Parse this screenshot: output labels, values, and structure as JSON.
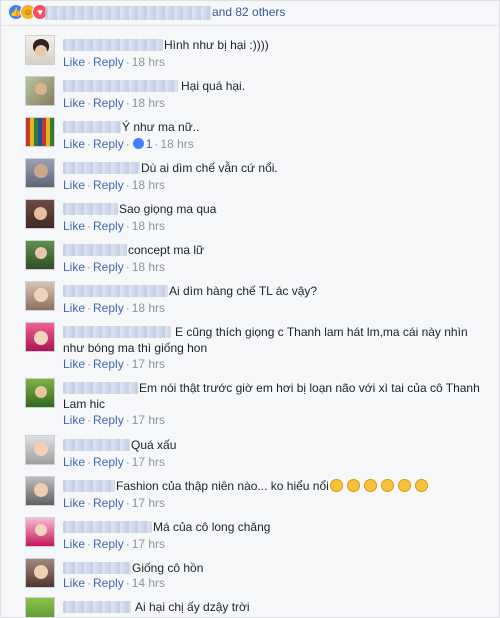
{
  "reactions_bar": {
    "others_text": "and 82 others",
    "reaction_types": [
      "like",
      "haha",
      "love"
    ],
    "colors": {
      "like": "#4080ff",
      "haha": "#f7b125",
      "love": "#f25268"
    }
  },
  "actions": {
    "like": "Like",
    "reply": "Reply",
    "separator": "·"
  },
  "colors": {
    "link": "#4267b2",
    "meta": "#90949c",
    "text": "#1d2129",
    "background": "#f6f7f9"
  },
  "comments": [
    {
      "text": "Hình như bị hại :))))",
      "time": "18 hrs"
    },
    {
      "text": "Hại quá hại.",
      "time": "18 hrs"
    },
    {
      "text": "Ý như ma nữ..",
      "time": "18 hrs",
      "reply_reactions": "1"
    },
    {
      "text": "Dù ai dìm chế vẫn cứ nổi.",
      "time": "18 hrs"
    },
    {
      "text": "Sao giọng ma qua",
      "time": "18 hrs"
    },
    {
      "text": "concept ma lữ",
      "time": "18 hrs"
    },
    {
      "text": "Ai dìm hàng chế TL ác vậy?",
      "time": "18 hrs"
    },
    {
      "text": "E cũng thích giọng c Thanh lam hát lm,ma cái này nhìn như bóng ma thì giống hon",
      "time": "17 hrs"
    },
    {
      "text": "Em nói thật trước giờ em hơi bị loạn não với xì tai của cô Thanh Lam hic",
      "time": "17 hrs"
    },
    {
      "text": "Quá xấu",
      "time": "17 hrs"
    },
    {
      "text": "Fashion của thập niên nào... ko hiểu nổi",
      "time": "17 hrs",
      "emoji_count": 6
    },
    {
      "text": "Má của cô long chăng",
      "time": "17 hrs"
    },
    {
      "text": "Giống cô hồn",
      "time": "14 hrs"
    },
    {
      "text": "Ai hại chị ấy dzậy trời",
      "time": ""
    }
  ]
}
